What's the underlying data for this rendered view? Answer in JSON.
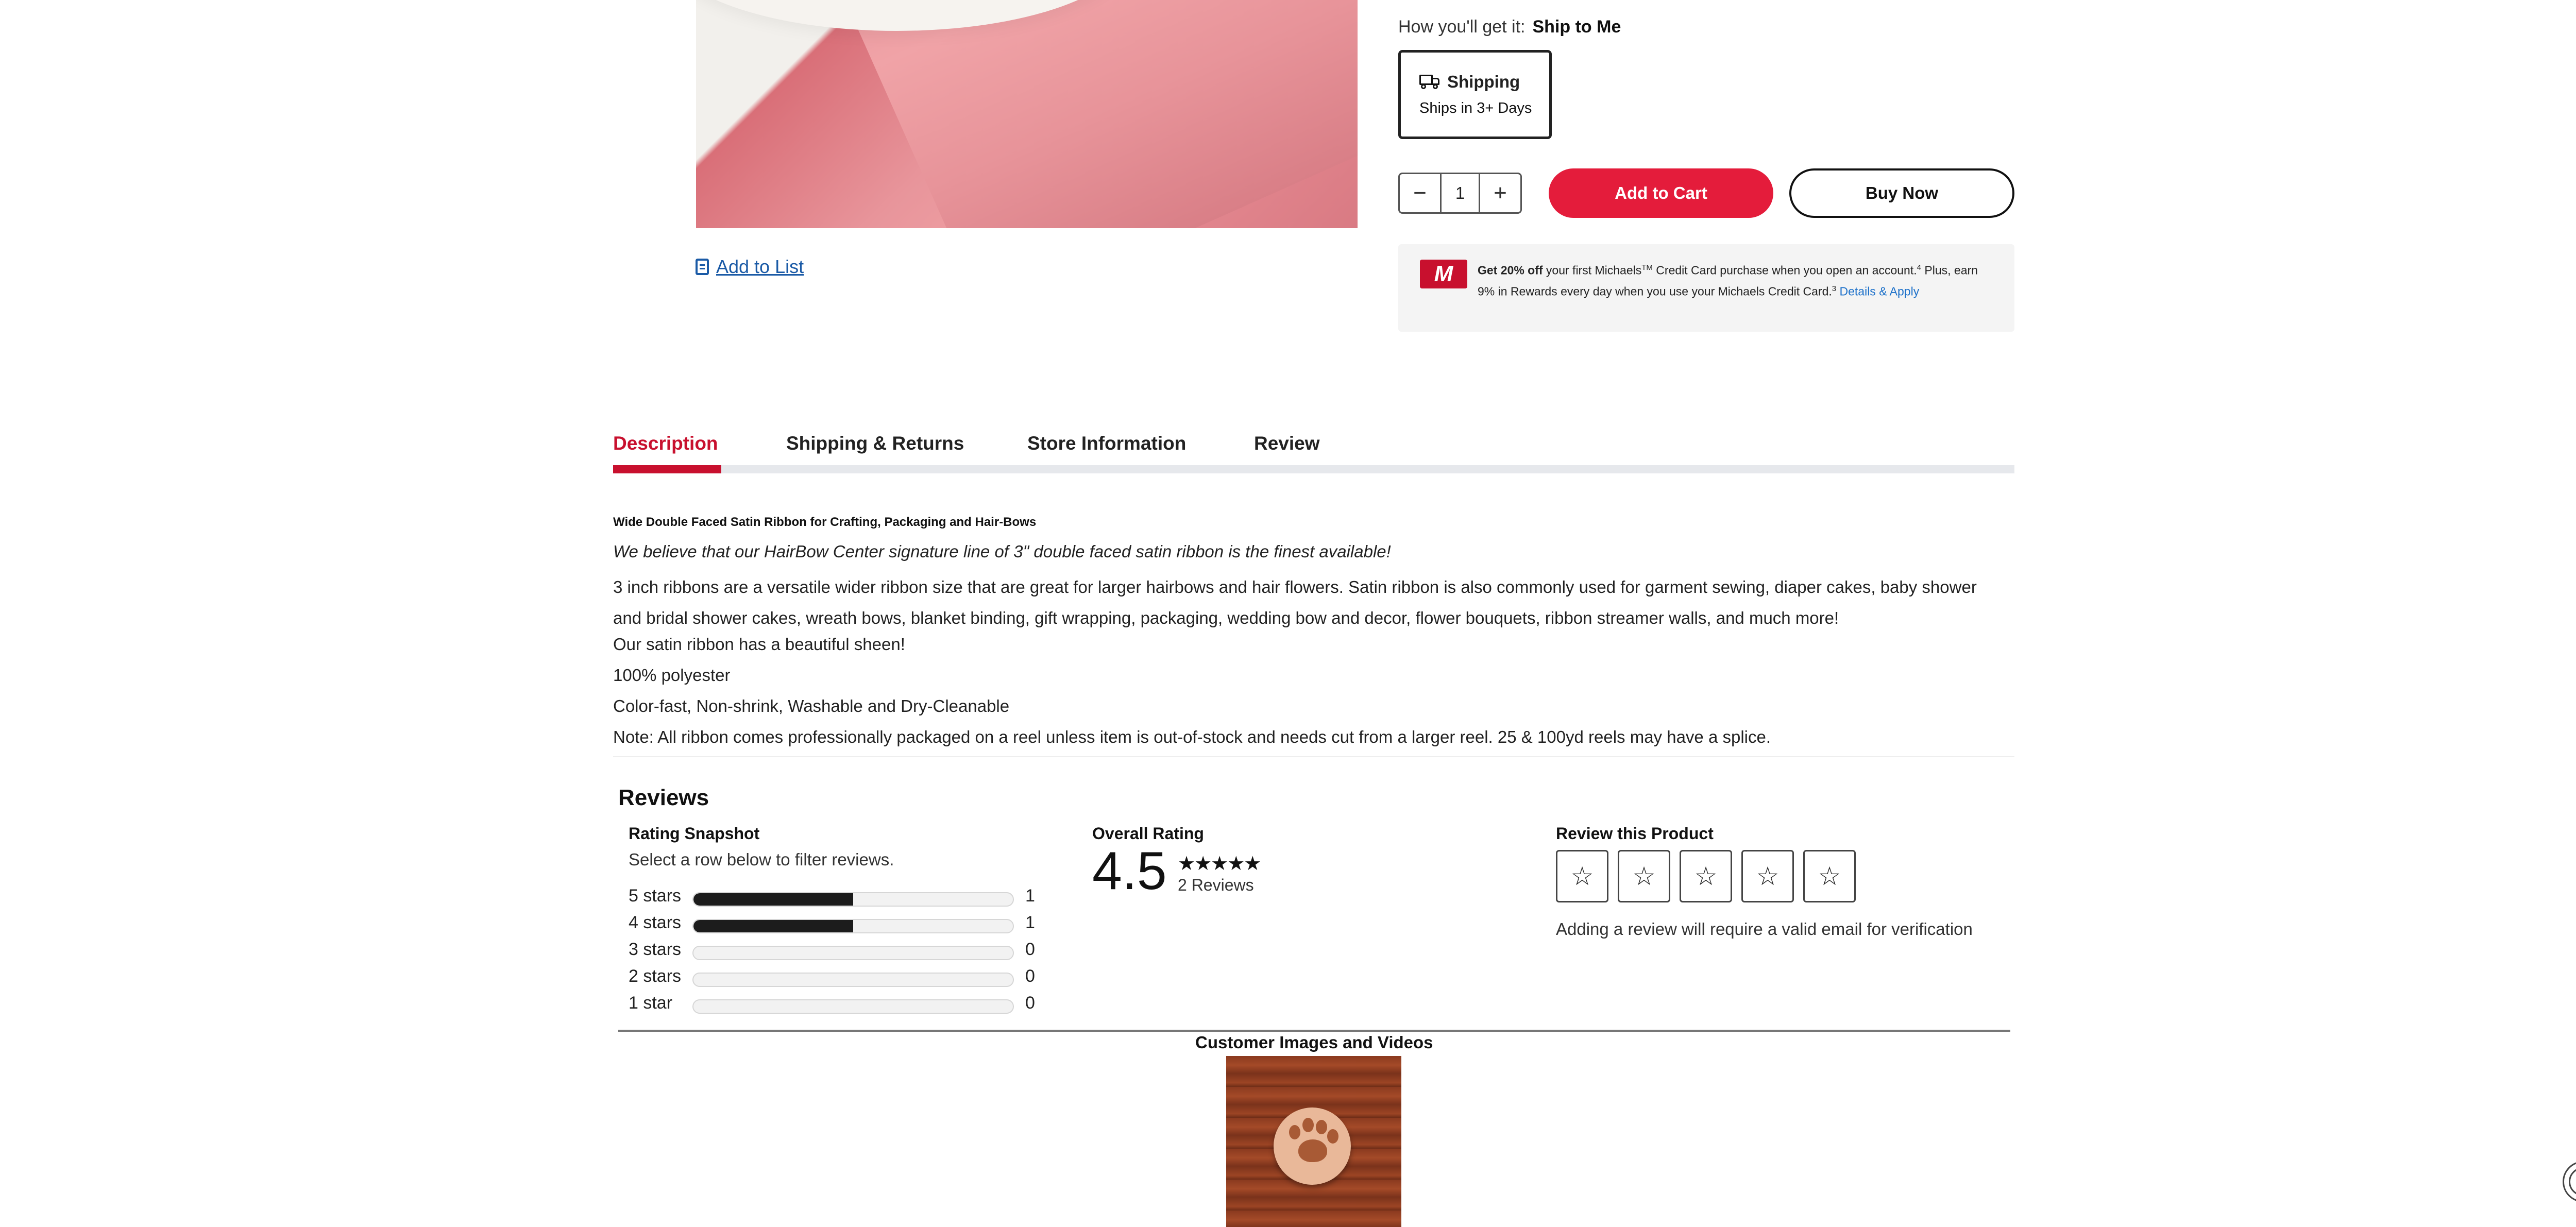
{
  "product": {
    "add_to_list": "Add to List",
    "how_get_label": "How you'll get it:",
    "how_get_value": "Ship to Me",
    "shipping": {
      "title": "Shipping",
      "sub": "Ships in 3+ Days"
    },
    "quantity": "1",
    "add_to_cart": "Add to Cart",
    "buy_now": "Buy Now"
  },
  "promo": {
    "logo": "M",
    "bold": "Get 20% off",
    "text1": " your first Michaels",
    "tm": "TM",
    "text2": " Credit Card purchase when you open an account.",
    "sup1": "4",
    "text3": " Plus, earn 9% in Rewards every day when you use your Michaels Credit Card.",
    "sup2": "3",
    "link": "Details & Apply"
  },
  "tabs": [
    "Description",
    "Shipping & Returns",
    "Store Information",
    "Review"
  ],
  "description": {
    "title": "Wide Double Faced Satin Ribbon for Crafting, Packaging and Hair-Bows",
    "lead": "We believe that our HairBow Center signature line of 3\" double faced satin ribbon is the finest available!",
    "para": "3 inch ribbons are a versatile wider ribbon size that are great for larger hairbows and hair flowers. Satin ribbon is also commonly used for garment sewing, diaper cakes, baby shower and bridal shower cakes, wreath bows, blanket binding, gift wrapping, packaging, wedding bow and decor, flower bouquets, ribbon streamer walls, and much more!",
    "lines": [
      "Our satin ribbon has a beautiful sheen!",
      "100% polyester",
      "Color-fast, Non-shrink, Washable and Dry-Cleanable",
      "Note: All ribbon comes professionally packaged on a reel unless item is out-of-stock and needs cut from a larger reel. 25 & 100yd reels may have a splice."
    ]
  },
  "reviews": {
    "heading": "Reviews",
    "snapshot_title": "Rating Snapshot",
    "snapshot_sub": "Select a row below to filter reviews.",
    "rows": [
      {
        "label": "5 stars",
        "count": "1",
        "fraction": 0.5
      },
      {
        "label": "4 stars",
        "count": "1",
        "fraction": 0.5
      },
      {
        "label": "3 stars",
        "count": "0",
        "fraction": 0
      },
      {
        "label": "2 stars",
        "count": "0",
        "fraction": 0
      },
      {
        "label": "1 star",
        "count": "0",
        "fraction": 0
      }
    ],
    "overall_title": "Overall Rating",
    "overall_value": "4.5",
    "overall_stars": "★★★★★",
    "overall_count": "2 Reviews",
    "review_title": "Review this Product",
    "review_stars": [
      "☆",
      "☆",
      "☆",
      "☆",
      "☆"
    ],
    "review_note": "Adding a review will require a valid email for verification"
  },
  "customer_media": {
    "title": "Customer Images and Videos"
  },
  "colors": {
    "accent": "#e41c3b",
    "link": "#1a5aa6",
    "tab_active": "#c8102e"
  }
}
